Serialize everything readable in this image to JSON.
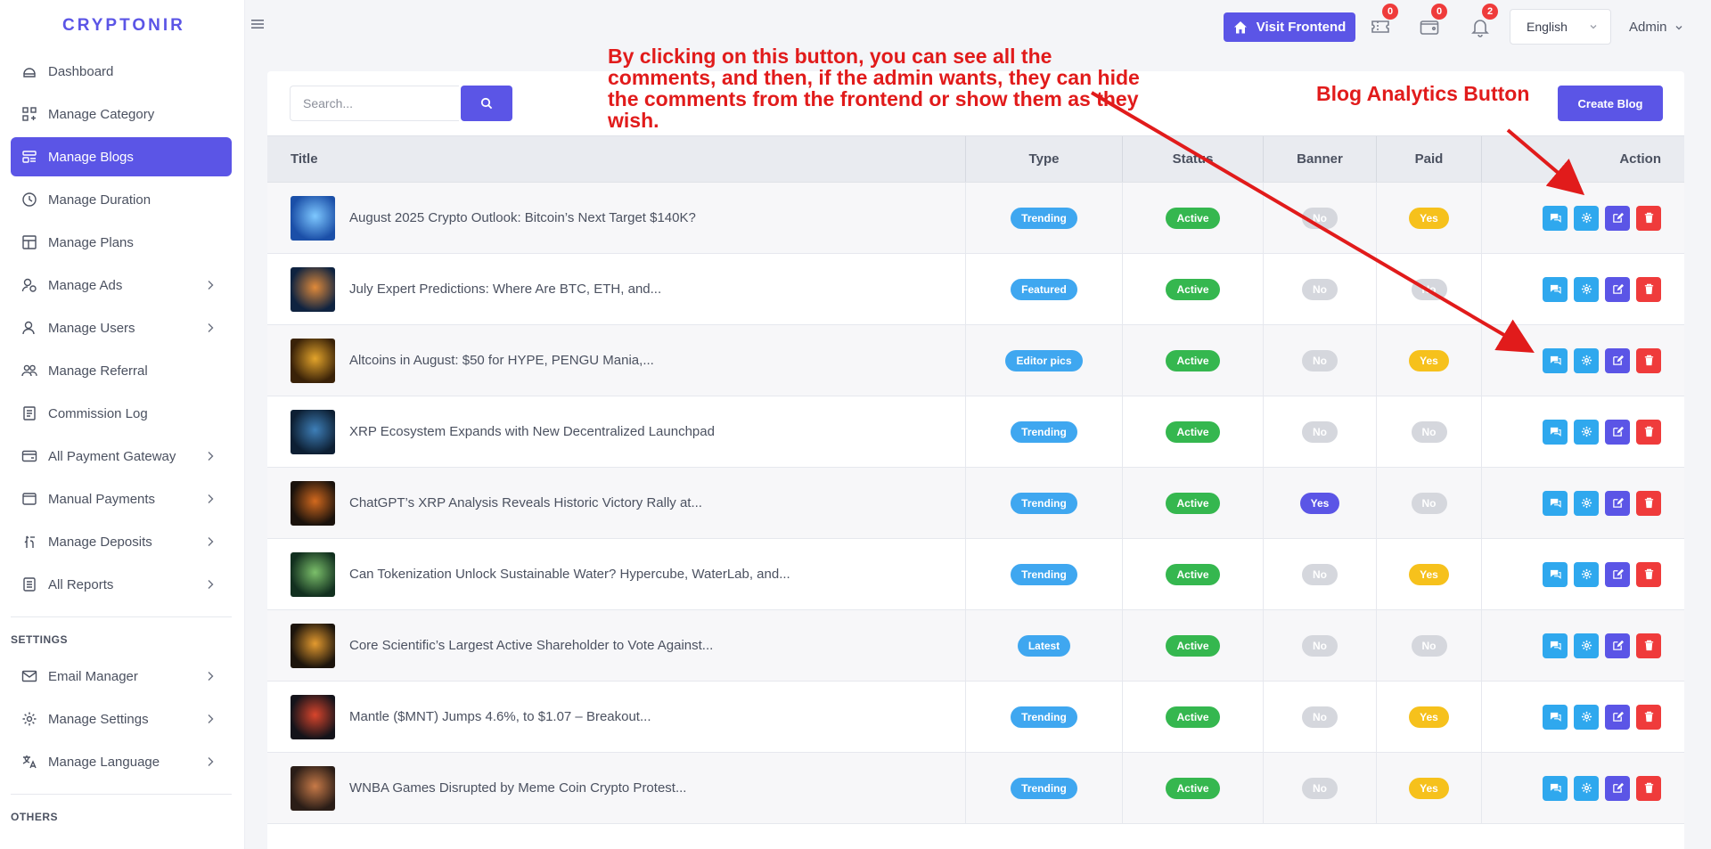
{
  "brand": "CRYPTONIR",
  "sidebar": {
    "items": [
      {
        "label": "Dashboard",
        "icon": "dashboard-icon",
        "active": false,
        "chevron": false
      },
      {
        "label": "Manage Category",
        "icon": "category-icon",
        "active": false,
        "chevron": false
      },
      {
        "label": "Manage Blogs",
        "icon": "blog-icon",
        "active": true,
        "chevron": false
      },
      {
        "label": "Manage Duration",
        "icon": "duration-icon",
        "active": false,
        "chevron": false
      },
      {
        "label": "Manage Plans",
        "icon": "plans-icon",
        "active": false,
        "chevron": false
      },
      {
        "label": "Manage Ads",
        "icon": "ads-icon",
        "active": false,
        "chevron": true
      },
      {
        "label": "Manage Users",
        "icon": "users-icon",
        "active": false,
        "chevron": true
      },
      {
        "label": "Manage Referral",
        "icon": "referral-icon",
        "active": false,
        "chevron": false
      },
      {
        "label": "Commission Log",
        "icon": "log-icon",
        "active": false,
        "chevron": false
      },
      {
        "label": "All Payment Gateway",
        "icon": "gateway-icon",
        "active": false,
        "chevron": true
      },
      {
        "label": "Manual Payments",
        "icon": "manual-payment-icon",
        "active": false,
        "chevron": true
      },
      {
        "label": "Manage Deposits",
        "icon": "deposit-icon",
        "active": false,
        "chevron": true
      },
      {
        "label": "All Reports",
        "icon": "reports-icon",
        "active": false,
        "chevron": true
      }
    ],
    "settings_heading": "SETTINGS",
    "settings_items": [
      {
        "label": "Email Manager",
        "icon": "email-icon",
        "chevron": true
      },
      {
        "label": "Manage Settings",
        "icon": "settings-icon",
        "chevron": true
      },
      {
        "label": "Manage Language",
        "icon": "language-icon",
        "chevron": true
      }
    ],
    "others_heading": "OTHERS"
  },
  "header": {
    "visit_frontend": "Visit Frontend",
    "ticket_count": "0",
    "wallet_count": "0",
    "notification_count": "2",
    "language": "English",
    "user": "Admin"
  },
  "toolbar": {
    "search_placeholder": "Search...",
    "create_blog": "Create Blog"
  },
  "table": {
    "columns": [
      "Title",
      "Type",
      "Status",
      "Banner",
      "Paid",
      "Action"
    ],
    "rows": [
      {
        "title": "August 2025 Crypto Outlook: Bitcoin’s Next Target $140K?",
        "type": "Trending",
        "status": "Active",
        "banner": "No",
        "paid": "Yes",
        "thumb": [
          "#1b4fa8",
          "#7ec8ff"
        ]
      },
      {
        "title": "July Expert Predictions: Where Are BTC, ETH, and...",
        "type": "Featured",
        "status": "Active",
        "banner": "No",
        "paid": "No",
        "thumb": [
          "#0f2340",
          "#e08a3a"
        ]
      },
      {
        "title": "Altcoins in August: $50 for HYPE, PENGU Mania,...",
        "type": "Editor pics",
        "status": "Active",
        "banner": "No",
        "paid": "Yes",
        "thumb": [
          "#3a2208",
          "#e3a42b"
        ]
      },
      {
        "title": "XRP Ecosystem Expands with New Decentralized Launchpad",
        "type": "Trending",
        "status": "Active",
        "banner": "No",
        "paid": "No",
        "thumb": [
          "#0d1f33",
          "#3e7fb8"
        ]
      },
      {
        "title": "ChatGPT’s XRP Analysis Reveals Historic Victory Rally at...",
        "type": "Trending",
        "status": "Active",
        "banner": "Yes",
        "paid": "No",
        "thumb": [
          "#1a120c",
          "#d2691e"
        ]
      },
      {
        "title": "Can Tokenization Unlock Sustainable Water? Hypercube, WaterLab, and...",
        "type": "Trending",
        "status": "Active",
        "banner": "No",
        "paid": "Yes",
        "thumb": [
          "#12301f",
          "#7bbf6a"
        ]
      },
      {
        "title": "Core Scientific’s Largest Active Shareholder to Vote Against...",
        "type": "Latest",
        "status": "Active",
        "banner": "No",
        "paid": "No",
        "thumb": [
          "#1c140c",
          "#e39a2f"
        ]
      },
      {
        "title": "Mantle ($MNT) Jumps 4.6%, to $1.07 – Breakout...",
        "type": "Trending",
        "status": "Active",
        "banner": "No",
        "paid": "Yes",
        "thumb": [
          "#14131a",
          "#d8452c"
        ]
      },
      {
        "title": "WNBA Games Disrupted by Meme Coin Crypto Protest...",
        "type": "Trending",
        "status": "Active",
        "banner": "No",
        "paid": "Yes",
        "thumb": [
          "#2a1d17",
          "#c77a48"
        ]
      }
    ]
  },
  "annotations": {
    "comments_note": "By clicking on this button, you can see all the comments, and then, if the admin wants, they can hide the comments from the frontend or show them as they wish.",
    "analytics_note": "Blog Analytics Button",
    "color": "#e11b1b"
  },
  "colors": {
    "primary": "#5b55e6",
    "info": "#3fa7f0",
    "success": "#35b74f",
    "warning": "#f6c11c",
    "danger": "#ef3b3b",
    "muted": "#d5d7dd"
  }
}
